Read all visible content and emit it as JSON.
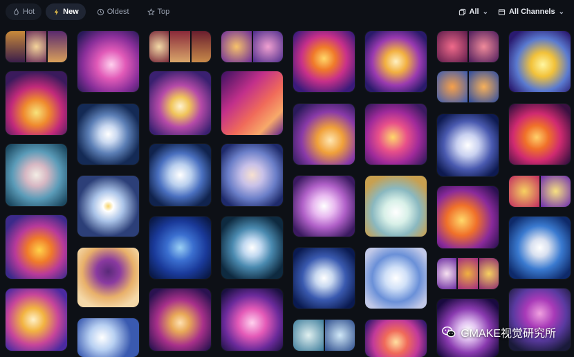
{
  "tabs": [
    {
      "label": "Hot",
      "icon": "flame-icon"
    },
    {
      "label": "New",
      "icon": "bolt-icon"
    },
    {
      "label": "Oldest",
      "icon": "clock-icon"
    },
    {
      "label": "Top",
      "icon": "star-icon"
    }
  ],
  "active_tab": "New",
  "filters": {
    "type_label": "All",
    "type_icon": "copy-icon",
    "channel_label": "All Channels",
    "channel_icon": "folder-icon"
  },
  "watermark": {
    "text": "GMAKE视觉研究所",
    "icon": "wechat-icon"
  },
  "colors": {
    "background": "#0d1016",
    "active_tab_bg": "#1f2533",
    "text": "#d7dbe3"
  },
  "gallery_images": [
    "flower-art",
    "flower-art",
    "flower-art",
    "flower-art",
    "flower-art",
    "flower-art",
    "flower-art",
    "flower-art",
    "flower-art",
    "flower-art"
  ]
}
